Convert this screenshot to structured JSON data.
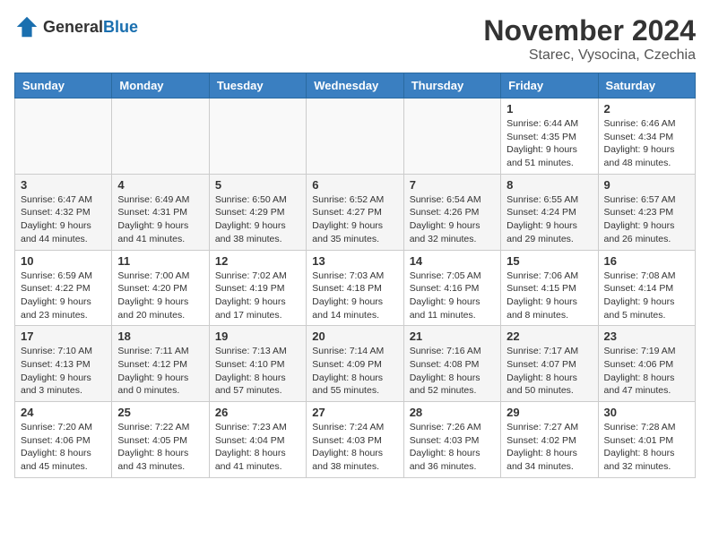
{
  "logo": {
    "general": "General",
    "blue": "Blue"
  },
  "title": "November 2024",
  "subtitle": "Starec, Vysocina, Czechia",
  "days_of_week": [
    "Sunday",
    "Monday",
    "Tuesday",
    "Wednesday",
    "Thursday",
    "Friday",
    "Saturday"
  ],
  "weeks": [
    [
      {
        "day": "",
        "empty": true
      },
      {
        "day": "",
        "empty": true
      },
      {
        "day": "",
        "empty": true
      },
      {
        "day": "",
        "empty": true
      },
      {
        "day": "",
        "empty": true
      },
      {
        "day": "1",
        "sunrise": "6:44 AM",
        "sunset": "4:35 PM",
        "daylight": "9 hours and 51 minutes."
      },
      {
        "day": "2",
        "sunrise": "6:46 AM",
        "sunset": "4:34 PM",
        "daylight": "9 hours and 48 minutes."
      }
    ],
    [
      {
        "day": "3",
        "sunrise": "6:47 AM",
        "sunset": "4:32 PM",
        "daylight": "9 hours and 44 minutes."
      },
      {
        "day": "4",
        "sunrise": "6:49 AM",
        "sunset": "4:31 PM",
        "daylight": "9 hours and 41 minutes."
      },
      {
        "day": "5",
        "sunrise": "6:50 AM",
        "sunset": "4:29 PM",
        "daylight": "9 hours and 38 minutes."
      },
      {
        "day": "6",
        "sunrise": "6:52 AM",
        "sunset": "4:27 PM",
        "daylight": "9 hours and 35 minutes."
      },
      {
        "day": "7",
        "sunrise": "6:54 AM",
        "sunset": "4:26 PM",
        "daylight": "9 hours and 32 minutes."
      },
      {
        "day": "8",
        "sunrise": "6:55 AM",
        "sunset": "4:24 PM",
        "daylight": "9 hours and 29 minutes."
      },
      {
        "day": "9",
        "sunrise": "6:57 AM",
        "sunset": "4:23 PM",
        "daylight": "9 hours and 26 minutes."
      }
    ],
    [
      {
        "day": "10",
        "sunrise": "6:59 AM",
        "sunset": "4:22 PM",
        "daylight": "9 hours and 23 minutes."
      },
      {
        "day": "11",
        "sunrise": "7:00 AM",
        "sunset": "4:20 PM",
        "daylight": "9 hours and 20 minutes."
      },
      {
        "day": "12",
        "sunrise": "7:02 AM",
        "sunset": "4:19 PM",
        "daylight": "9 hours and 17 minutes."
      },
      {
        "day": "13",
        "sunrise": "7:03 AM",
        "sunset": "4:18 PM",
        "daylight": "9 hours and 14 minutes."
      },
      {
        "day": "14",
        "sunrise": "7:05 AM",
        "sunset": "4:16 PM",
        "daylight": "9 hours and 11 minutes."
      },
      {
        "day": "15",
        "sunrise": "7:06 AM",
        "sunset": "4:15 PM",
        "daylight": "9 hours and 8 minutes."
      },
      {
        "day": "16",
        "sunrise": "7:08 AM",
        "sunset": "4:14 PM",
        "daylight": "9 hours and 5 minutes."
      }
    ],
    [
      {
        "day": "17",
        "sunrise": "7:10 AM",
        "sunset": "4:13 PM",
        "daylight": "9 hours and 3 minutes."
      },
      {
        "day": "18",
        "sunrise": "7:11 AM",
        "sunset": "4:12 PM",
        "daylight": "9 hours and 0 minutes."
      },
      {
        "day": "19",
        "sunrise": "7:13 AM",
        "sunset": "4:10 PM",
        "daylight": "8 hours and 57 minutes."
      },
      {
        "day": "20",
        "sunrise": "7:14 AM",
        "sunset": "4:09 PM",
        "daylight": "8 hours and 55 minutes."
      },
      {
        "day": "21",
        "sunrise": "7:16 AM",
        "sunset": "4:08 PM",
        "daylight": "8 hours and 52 minutes."
      },
      {
        "day": "22",
        "sunrise": "7:17 AM",
        "sunset": "4:07 PM",
        "daylight": "8 hours and 50 minutes."
      },
      {
        "day": "23",
        "sunrise": "7:19 AM",
        "sunset": "4:06 PM",
        "daylight": "8 hours and 47 minutes."
      }
    ],
    [
      {
        "day": "24",
        "sunrise": "7:20 AM",
        "sunset": "4:06 PM",
        "daylight": "8 hours and 45 minutes."
      },
      {
        "day": "25",
        "sunrise": "7:22 AM",
        "sunset": "4:05 PM",
        "daylight": "8 hours and 43 minutes."
      },
      {
        "day": "26",
        "sunrise": "7:23 AM",
        "sunset": "4:04 PM",
        "daylight": "8 hours and 41 minutes."
      },
      {
        "day": "27",
        "sunrise": "7:24 AM",
        "sunset": "4:03 PM",
        "daylight": "8 hours and 38 minutes."
      },
      {
        "day": "28",
        "sunrise": "7:26 AM",
        "sunset": "4:03 PM",
        "daylight": "8 hours and 36 minutes."
      },
      {
        "day": "29",
        "sunrise": "7:27 AM",
        "sunset": "4:02 PM",
        "daylight": "8 hours and 34 minutes."
      },
      {
        "day": "30",
        "sunrise": "7:28 AM",
        "sunset": "4:01 PM",
        "daylight": "8 hours and 32 minutes."
      }
    ]
  ],
  "labels": {
    "sunrise": "Sunrise:",
    "sunset": "Sunset:",
    "daylight": "Daylight:"
  }
}
